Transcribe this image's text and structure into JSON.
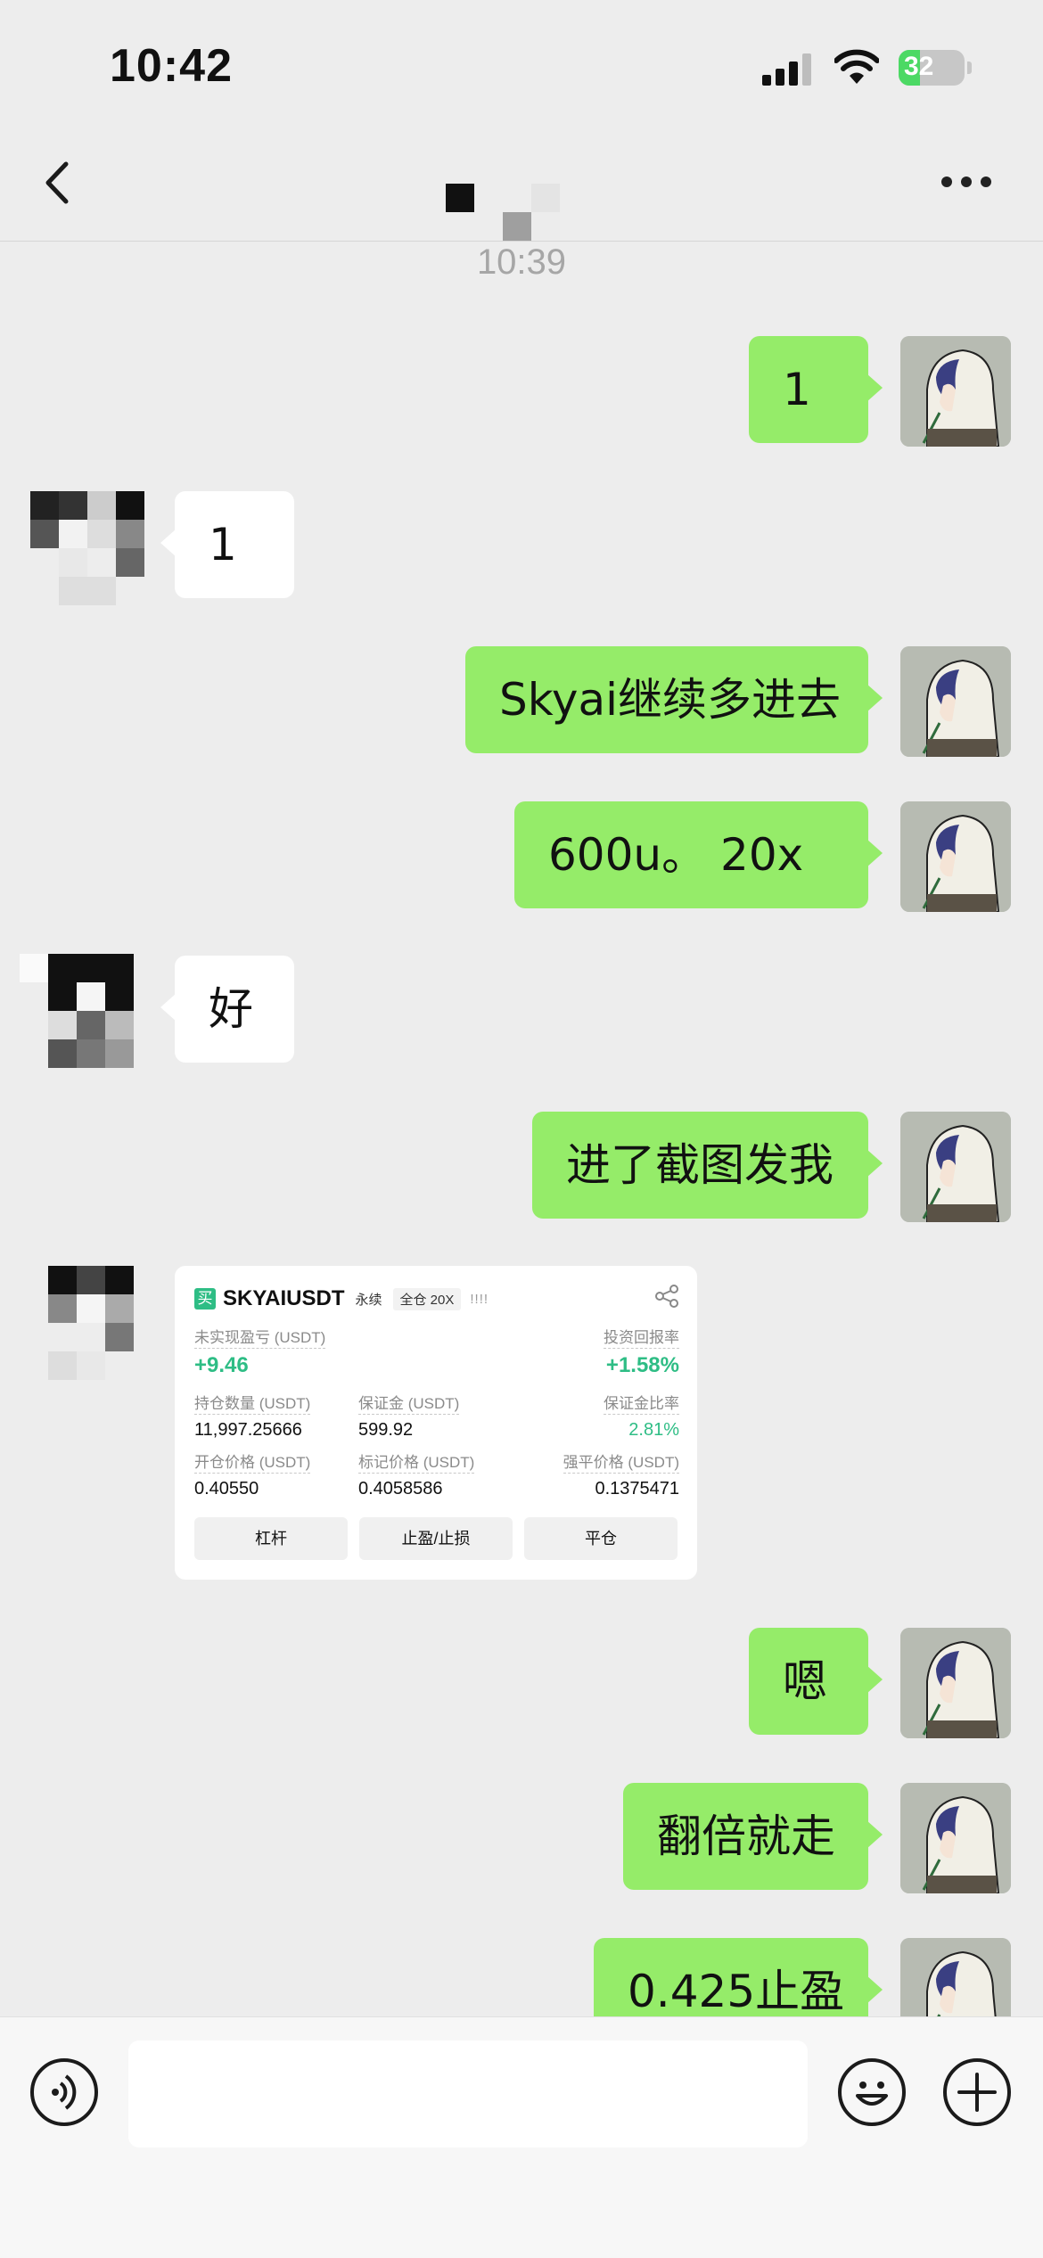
{
  "status_bar": {
    "time": "10:42",
    "battery": "32",
    "battery_level": 0.32
  },
  "header": {
    "contact_name": ""
  },
  "timestamp": "10:39",
  "messages": [
    {
      "from": "me",
      "text": "1"
    },
    {
      "from": "other",
      "text": "1"
    },
    {
      "from": "me",
      "text": "Skyai继续多进去"
    },
    {
      "from": "me",
      "text": "600u。     20x"
    },
    {
      "from": "other",
      "text": "好"
    },
    {
      "from": "me",
      "text": "进了截图发我"
    },
    {
      "from": "other",
      "type": "image"
    },
    {
      "from": "me",
      "text": "嗯"
    },
    {
      "from": "me",
      "text": "翻倍就走"
    },
    {
      "from": "me",
      "text": "0.425止盈"
    }
  ],
  "trade_card": {
    "buy_tag": "买",
    "symbol": "SKYAIUSDT",
    "contract": "永续",
    "margin_mode": "全仓 20X",
    "bars": "!!!!",
    "unrealized_pnl_label": "未实现盈亏 (USDT)",
    "unrealized_pnl": "+9.46",
    "roi_label": "投资回报率",
    "roi": "+1.58%",
    "size_label": "持仓数量 (USDT)",
    "size": "11,997.25666",
    "margin_label": "保证金 (USDT)",
    "margin": "599.92",
    "margin_ratio_label": "保证金比率",
    "margin_ratio": "2.81%",
    "entry_price_label": "开仓价格 (USDT)",
    "entry_price": "0.40550",
    "mark_price_label": "标记价格 (USDT)",
    "mark_price": "0.4058586",
    "liq_price_label": "强平价格 (USDT)",
    "liq_price": "0.1375471",
    "buttons": [
      "杠杆",
      "止盈/止损",
      "平仓"
    ]
  },
  "input_bar": {
    "placeholder": ""
  },
  "colors": {
    "bubble_out": "#95ec69",
    "bubble_in": "#ffffff",
    "profit_green": "#2ebd85",
    "background": "#ededed"
  }
}
